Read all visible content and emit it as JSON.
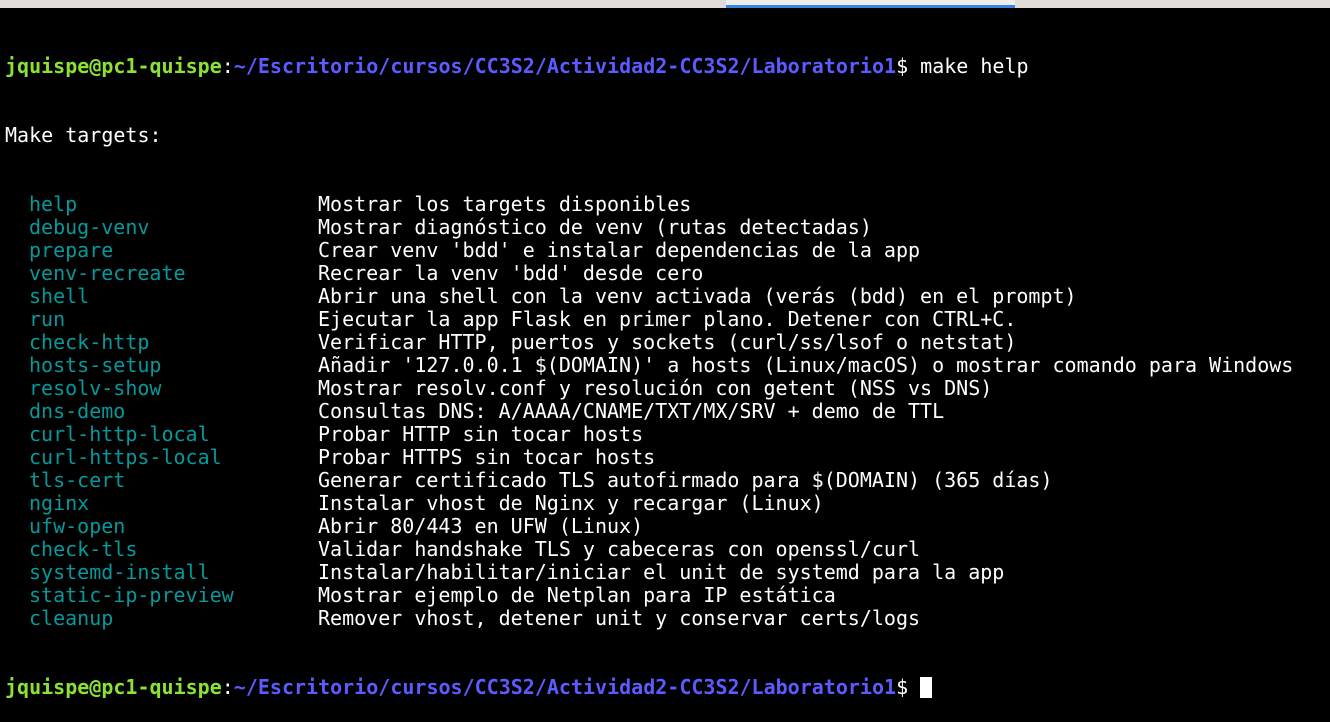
{
  "prompt": {
    "user_host": "jquispe@pc1-quispe",
    "sep": ":",
    "path": "~/Escritorio/cursos/CC3S2/Actividad2-CC3S2/Laboratorio1",
    "symbol": "$"
  },
  "command": " make help",
  "header": "Make targets:",
  "targets": [
    {
      "name": "help",
      "desc": "Mostrar los targets disponibles"
    },
    {
      "name": "debug-venv",
      "desc": "Mostrar diagnóstico de venv (rutas detectadas)"
    },
    {
      "name": "prepare",
      "desc": "Crear venv 'bdd' e instalar dependencias de la app"
    },
    {
      "name": "venv-recreate",
      "desc": "Recrear la venv 'bdd' desde cero"
    },
    {
      "name": "shell",
      "desc": "Abrir una shell con la venv activada (verás (bdd) en el prompt)"
    },
    {
      "name": "run",
      "desc": "Ejecutar la app Flask en primer plano. Detener con CTRL+C."
    },
    {
      "name": "check-http",
      "desc": "Verificar HTTP, puertos y sockets (curl/ss/lsof o netstat)"
    },
    {
      "name": "hosts-setup",
      "desc": "Añadir '127.0.0.1 $(DOMAIN)' a hosts (Linux/macOS) o mostrar comando para Windows"
    },
    {
      "name": "resolv-show",
      "desc": "Mostrar resolv.conf y resolución con getent (NSS vs DNS)"
    },
    {
      "name": "dns-demo",
      "desc": "Consultas DNS: A/AAAA/CNAME/TXT/MX/SRV + demo de TTL"
    },
    {
      "name": "curl-http-local",
      "desc": "Probar HTTP sin tocar hosts"
    },
    {
      "name": "curl-https-local",
      "desc": "Probar HTTPS sin tocar hosts"
    },
    {
      "name": "tls-cert",
      "desc": "Generar certificado TLS autofirmado para $(DOMAIN) (365 días)"
    },
    {
      "name": "nginx",
      "desc": "Instalar vhost de Nginx y recargar (Linux)"
    },
    {
      "name": "ufw-open",
      "desc": "Abrir 80/443 en UFW (Linux)"
    },
    {
      "name": "check-tls",
      "desc": "Validar handshake TLS y cabeceras con openssl/curl"
    },
    {
      "name": "systemd-install",
      "desc": "Instalar/habilitar/iniciar el unit de systemd para la app"
    },
    {
      "name": "static-ip-preview",
      "desc": "Mostrar ejemplo de Netplan para IP estática"
    },
    {
      "name": "cleanup",
      "desc": "Remover vhost, detener unit y conservar certs/logs"
    }
  ],
  "colors": {
    "user": "#8ae234",
    "path": "#5b5bff",
    "target": "#06989a",
    "text": "#ffffff",
    "background": "#000000",
    "tab_indicator": "#3584e4"
  }
}
